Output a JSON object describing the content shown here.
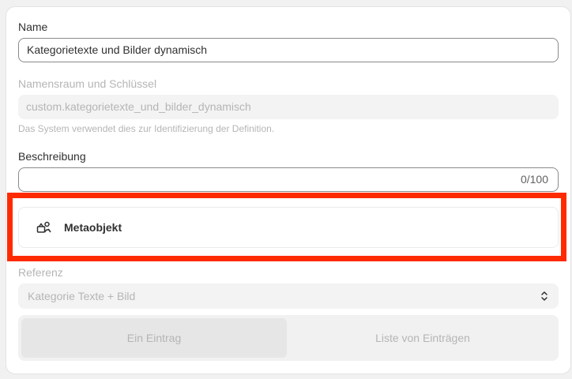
{
  "name_field": {
    "label": "Name",
    "value": "Kategorietexte und Bilder dynamisch"
  },
  "namespace_field": {
    "label": "Namensraum und Schlüssel",
    "value": "custom.kategorietexte_und_bilder_dynamisch",
    "help": "Das System verwendet dies zur Identifizierung der Definition."
  },
  "description_field": {
    "label": "Beschreibung",
    "value": "",
    "counter": "0/100"
  },
  "type": {
    "icon": "metaobject-icon",
    "label": "Metaobjekt"
  },
  "reference_field": {
    "label": "Referenz",
    "selected": "Kategorie Texte + Bild"
  },
  "entry_toggle": {
    "options": [
      "Ein Eintrag",
      "Liste von Einträgen"
    ],
    "selected_index": 0
  },
  "colors": {
    "highlight": "#ff2b00",
    "text": "#303030",
    "muted": "#b5b5b5",
    "border": "#8a8a8a"
  }
}
